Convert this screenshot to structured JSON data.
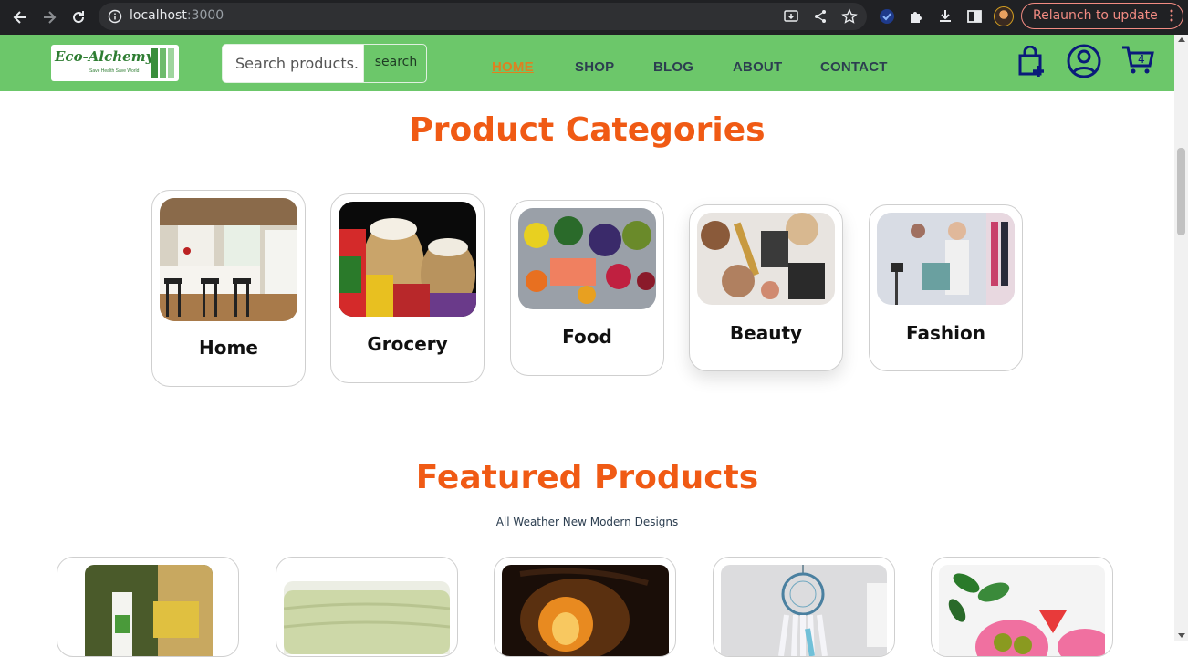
{
  "browser": {
    "url_host": "localhost",
    "url_port": ":3000",
    "relaunch_label": "Relaunch to update"
  },
  "header": {
    "logo_text": "Eco-Alchemy",
    "logo_tagline": "Save Health Save World",
    "search_placeholder": "Search products.",
    "search_button": "search",
    "nav": [
      {
        "label": "HOME",
        "active": true
      },
      {
        "label": "SHOP",
        "active": false
      },
      {
        "label": "BLOG",
        "active": false
      },
      {
        "label": "ABOUT",
        "active": false
      },
      {
        "label": "CONTACT",
        "active": false
      }
    ],
    "cart_count": "4"
  },
  "categories": {
    "title": "Product Categories",
    "items": [
      {
        "label": "Home"
      },
      {
        "label": "Grocery"
      },
      {
        "label": "Food"
      },
      {
        "label": "Beauty"
      },
      {
        "label": "Fashion"
      }
    ]
  },
  "featured": {
    "title": "Featured Products",
    "subtitle": "All Weather New Modern Designs"
  },
  "colors": {
    "header_bg": "#6cc76a",
    "accent_orange": "#f05a14",
    "active_nav": "#e08020",
    "chrome_bg": "#202124"
  }
}
